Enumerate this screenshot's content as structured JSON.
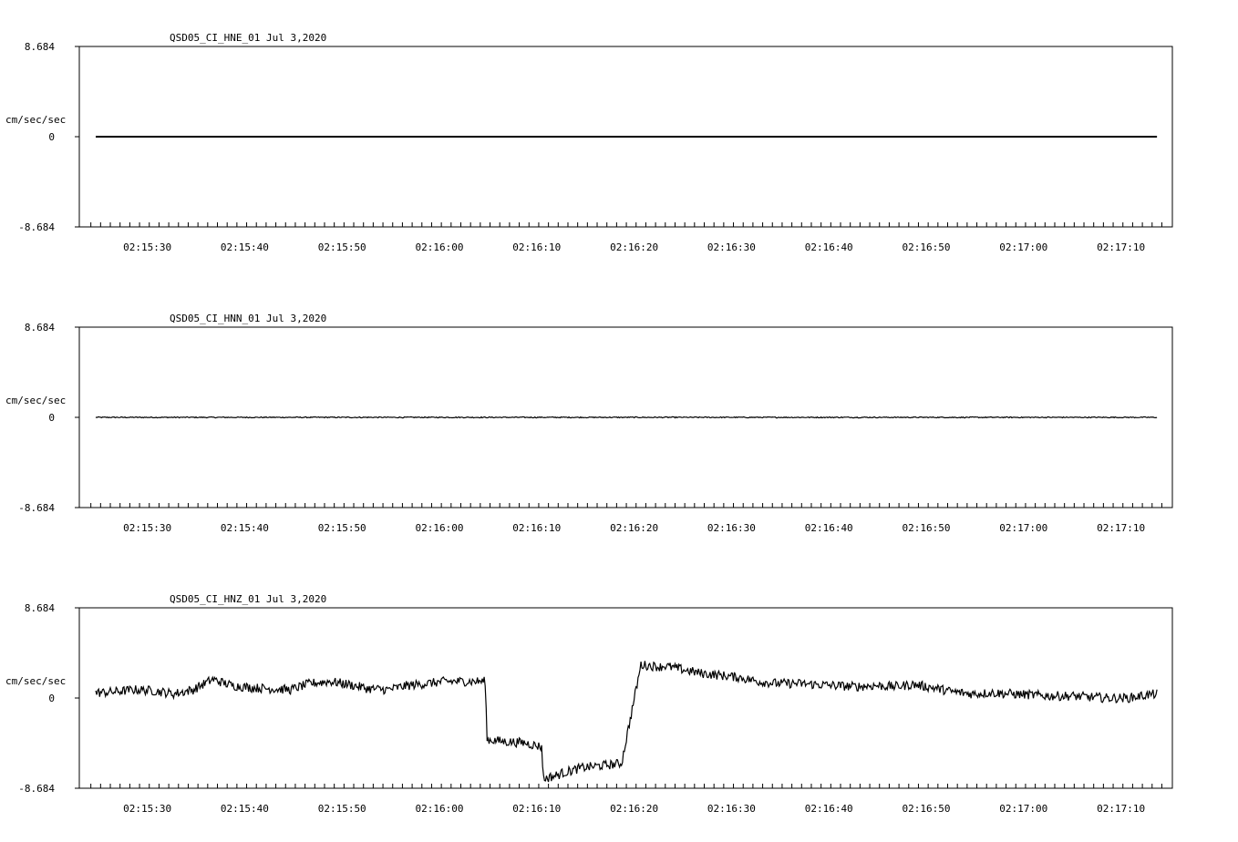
{
  "chart_data": [
    {
      "type": "line",
      "title": "QSD05_CI_HNE_01  Jul 3,2020",
      "ylabel": "cm/sec/sec",
      "ylim": [
        -8.684,
        8.684
      ],
      "ytick_labels": [
        "8.684",
        "0",
        "-8.684"
      ],
      "x_tick_labels": [
        "02:15:30",
        "02:15:40",
        "02:15:50",
        "02:16:00",
        "02:16:10",
        "02:16:20",
        "02:16:30",
        "02:16:40",
        "02:16:50",
        "02:17:00",
        "02:17:10"
      ],
      "series": [
        {
          "x_seconds": [
            0,
            109
          ],
          "values": [
            0.0,
            0.0
          ]
        }
      ]
    },
    {
      "type": "line",
      "title": "QSD05_CI_HNN_01  Jul 3,2020",
      "ylabel": "cm/sec/sec",
      "ylim": [
        -8.684,
        8.684
      ],
      "ytick_labels": [
        "8.684",
        "0",
        "-8.684"
      ],
      "x_tick_labels": [
        "02:15:30",
        "02:15:40",
        "02:15:50",
        "02:16:00",
        "02:16:10",
        "02:16:20",
        "02:16:30",
        "02:16:40",
        "02:16:50",
        "02:17:00",
        "02:17:10"
      ],
      "series": [
        {
          "x_seconds": [
            0,
            109
          ],
          "values": [
            0.0,
            0.0
          ]
        }
      ]
    },
    {
      "type": "line",
      "title": "QSD05_CI_HNZ_01  Jul 3,2020",
      "ylabel": "cm/sec/sec",
      "ylim": [
        -8.684,
        8.684
      ],
      "ytick_labels": [
        "8.684",
        "0",
        "-8.684"
      ],
      "x_tick_labels": [
        "02:15:30",
        "02:15:40",
        "02:15:50",
        "02:16:00",
        "02:16:10",
        "02:16:20",
        "02:16:30",
        "02:16:40",
        "02:16:50",
        "02:17:00",
        "02:17:10"
      ],
      "series": [
        {
          "x_seconds": [
            0,
            2,
            4,
            6,
            8,
            10,
            12,
            14,
            16,
            18,
            20,
            22,
            24,
            26,
            28,
            30,
            32,
            34,
            36,
            38,
            40,
            40.2,
            42,
            44,
            45.8,
            46,
            47.5,
            48,
            50,
            52,
            54,
            56,
            58,
            58.4,
            60,
            62,
            64,
            66,
            68,
            70,
            72,
            74,
            76,
            78,
            80,
            82,
            84,
            86,
            88,
            90,
            92,
            94,
            96,
            98,
            100,
            102,
            104,
            106,
            108,
            109
          ],
          "values": [
            0.5,
            0.6,
            0.8,
            0.7,
            0.4,
            0.8,
            1.8,
            1.2,
            1.0,
            0.9,
            0.8,
            1.4,
            1.6,
            1.3,
            0.9,
            0.8,
            1.2,
            1.4,
            1.6,
            1.6,
            1.6,
            -4.0,
            -4.2,
            -4.3,
            -4.7,
            -7.8,
            -7.4,
            -7.2,
            -6.7,
            -6.5,
            -6.3,
            3.2,
            3.0,
            3.1,
            2.8,
            2.4,
            2.2,
            2.0,
            1.6,
            1.4,
            1.4,
            1.3,
            1.2,
            1.1,
            1.2,
            1.1,
            1.3,
            1.0,
            0.6,
            0.4,
            0.5,
            0.4,
            0.3,
            0.2,
            0.2,
            0.1,
            0.0,
            0.0,
            0.3,
            0.4
          ]
        }
      ]
    }
  ]
}
